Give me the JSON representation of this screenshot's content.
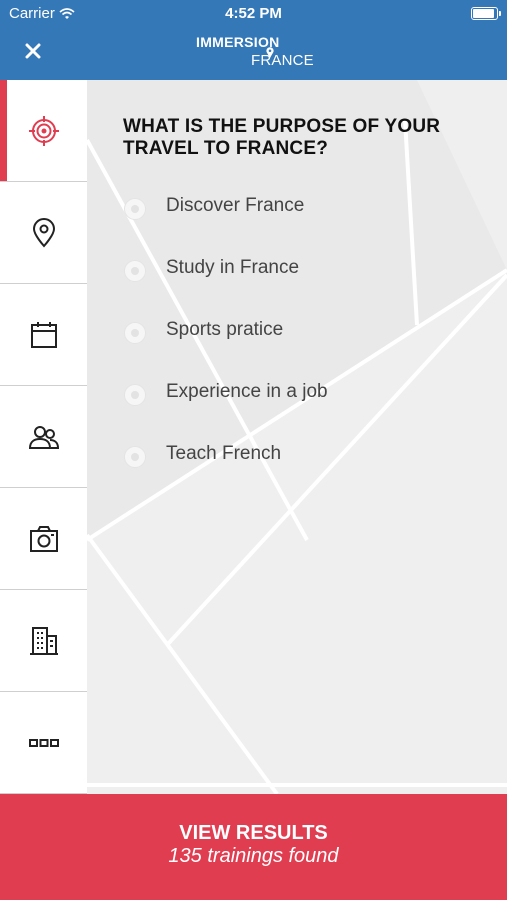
{
  "status_bar": {
    "carrier": "Carrier",
    "time": "4:52 PM",
    "battery_level": 0.95
  },
  "nav": {
    "close_icon": "close-icon",
    "logo_top": "IMMERSION",
    "logo_bottom": "FRANCE"
  },
  "sidebar": {
    "items": [
      {
        "icon": "target-icon",
        "active": true
      },
      {
        "icon": "map-pin-icon",
        "active": false
      },
      {
        "icon": "calendar-icon",
        "active": false
      },
      {
        "icon": "people-icon",
        "active": false
      },
      {
        "icon": "camera-icon",
        "active": false
      },
      {
        "icon": "building-icon",
        "active": false
      },
      {
        "icon": "more-icon",
        "active": false
      }
    ]
  },
  "main": {
    "question": "WHAT IS THE PURPOSE OF YOUR TRAVEL TO FRANCE?",
    "options": [
      {
        "label": "Discover France",
        "selected": false
      },
      {
        "label": "Study in France",
        "selected": false
      },
      {
        "label": "Sports pratice",
        "selected": false
      },
      {
        "label": "Experience in a job",
        "selected": false
      },
      {
        "label": "Teach French",
        "selected": false
      }
    ]
  },
  "footer": {
    "title": "VIEW RESULTS",
    "subtitle": "135 trainings found"
  },
  "colors": {
    "header": "#3478b8",
    "accent": "#e03d50",
    "panel": "#efefef"
  }
}
